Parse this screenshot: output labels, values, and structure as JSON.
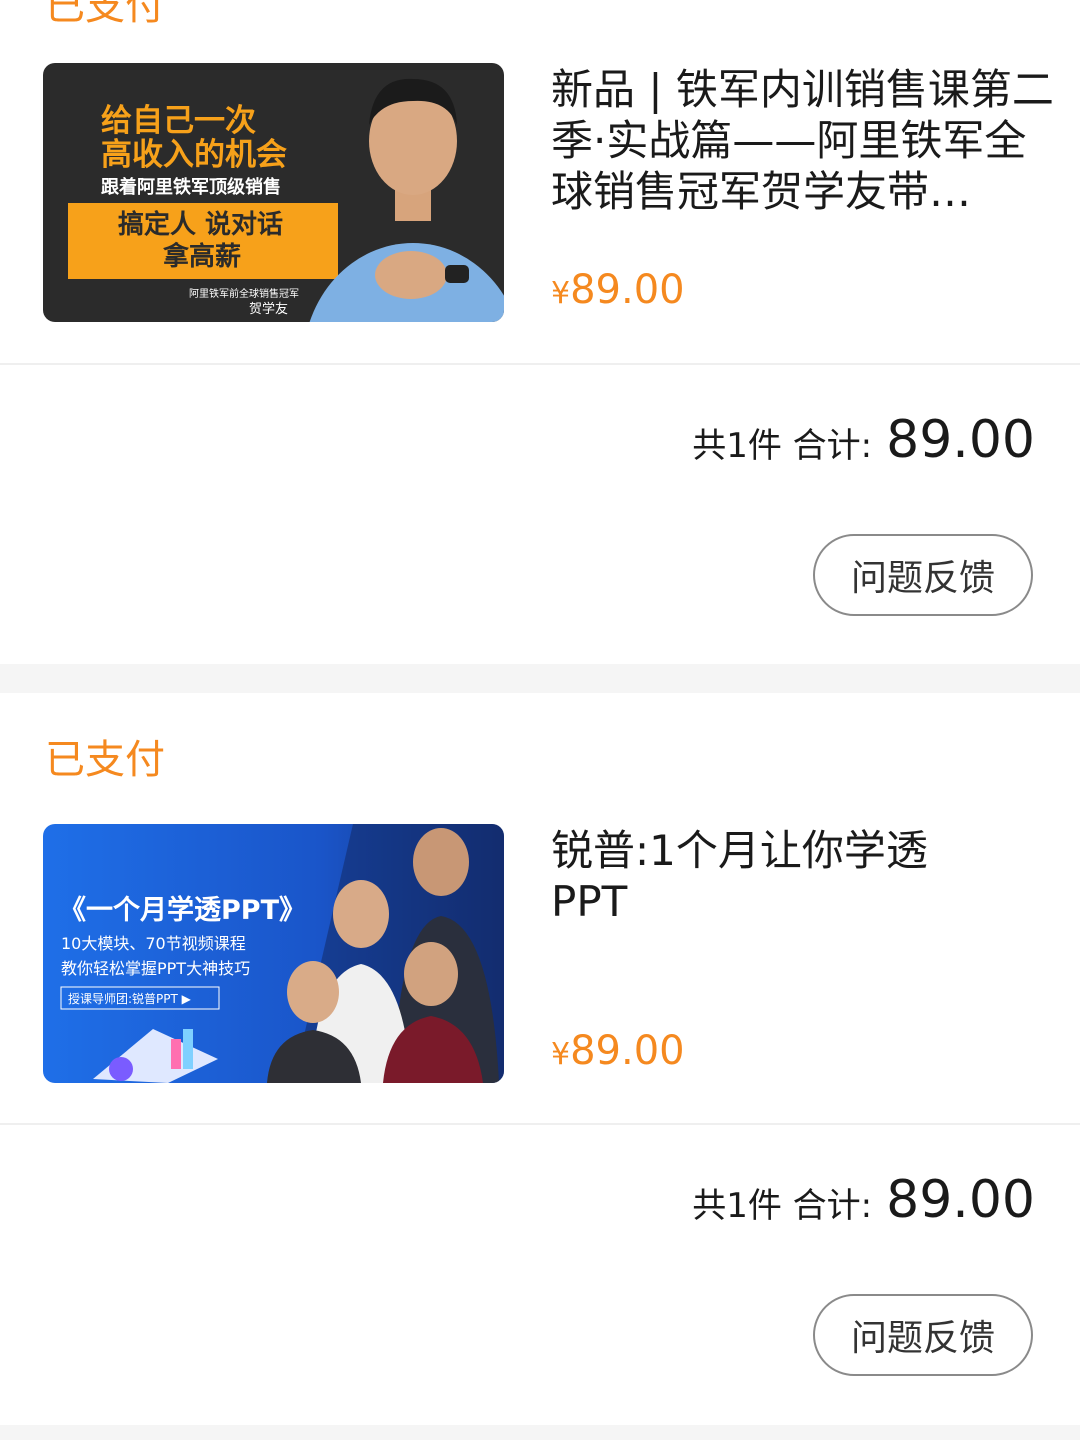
{
  "orders": [
    {
      "status": "已支付",
      "title": "新品 | 铁军内训销售课第二季·实战篇——阿里铁军全球销售冠军贺学友带…",
      "currency": "¥",
      "price": "89.00",
      "summary_label": "共1件 合计:",
      "total": "89.00",
      "feedback_label": "问题反馈",
      "cover": {
        "line1": "给自己一次",
        "line2": "高收入的机会",
        "line3": "跟着阿里铁军顶级销售",
        "line4": "搞定人 说对话",
        "line5": "拿高薪",
        "credit1": "阿里铁军前全球销售冠军",
        "credit2": "贺学友"
      }
    },
    {
      "status": "已支付",
      "title": "锐普:1个月让你学透 PPT",
      "currency": "¥",
      "price": "89.00",
      "summary_label": "共1件 合计:",
      "total": "89.00",
      "feedback_label": "问题反馈",
      "cover": {
        "line1": "《一个月学透PPT》",
        "line2": "10大模块、70节视频课程",
        "line3": "教你轻松掌握PPT大神技巧",
        "line4": "授课导师团:锐普PPT ▶"
      }
    }
  ],
  "colors": {
    "accent": "#f5891f",
    "card1_bg": "#2b2b2b",
    "card1_banner": "#f7a11a",
    "card2_bg": "#1e63e0"
  }
}
